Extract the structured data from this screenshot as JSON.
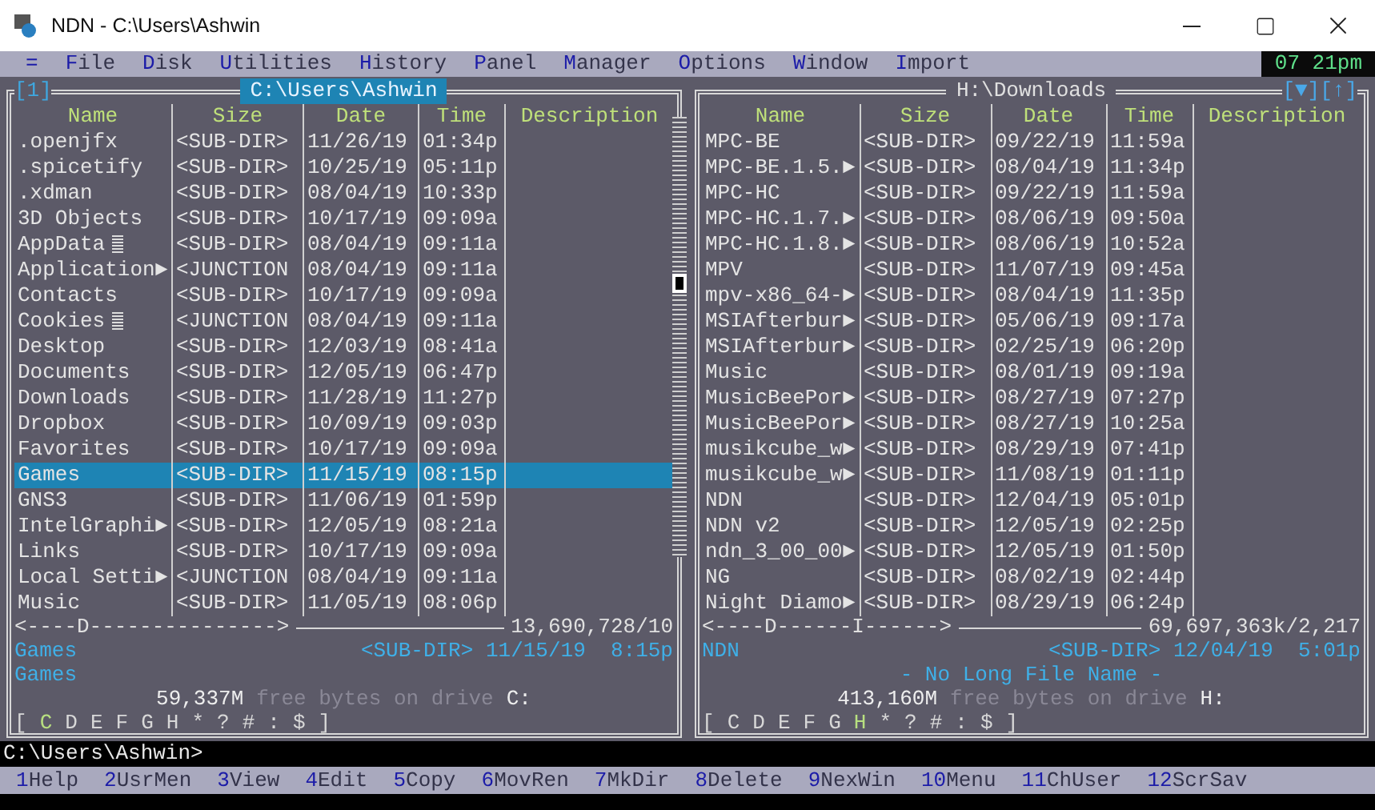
{
  "window": {
    "title": "NDN - C:\\Users\\Ashwin"
  },
  "menu": [
    {
      "label": "="
    },
    {
      "label": "File"
    },
    {
      "label": "Disk"
    },
    {
      "label": "Utilities"
    },
    {
      "label": "History"
    },
    {
      "label": "Panel"
    },
    {
      "label": "Manager"
    },
    {
      "label": "Options"
    },
    {
      "label": "Window"
    },
    {
      "label": "Import"
    }
  ],
  "clock": "07 21pm",
  "panels": [
    {
      "number": "[1]",
      "path": "C:\\Users\\Ashwin",
      "active": true,
      "columns": [
        "Name",
        "Size",
        "Date",
        "Time",
        "Description"
      ],
      "rows": [
        {
          "name": ".openjfx",
          "tagged": false,
          "size": "<SUB-DIR>",
          "date": "11/26/19",
          "time": "01:34p",
          "selected": false
        },
        {
          "name": ".spicetify",
          "tagged": false,
          "size": "<SUB-DIR>",
          "date": "10/25/19",
          "time": "05:11p",
          "selected": false
        },
        {
          "name": ".xdman",
          "tagged": false,
          "size": "<SUB-DIR>",
          "date": "08/04/19",
          "time": "10:33p",
          "selected": false
        },
        {
          "name": "3D Objects",
          "tagged": false,
          "size": "<SUB-DIR>",
          "date": "10/17/19",
          "time": "09:09a",
          "selected": false
        },
        {
          "name": "AppData",
          "tagged": true,
          "size": "<SUB-DIR>",
          "date": "08/04/19",
          "time": "09:11a",
          "selected": false
        },
        {
          "name": "Application►",
          "tagged": false,
          "size": "<JUNCTION",
          "date": "08/04/19",
          "time": "09:11a",
          "selected": false
        },
        {
          "name": "Contacts",
          "tagged": false,
          "size": "<SUB-DIR>",
          "date": "10/17/19",
          "time": "09:09a",
          "selected": false
        },
        {
          "name": "Cookies",
          "tagged": true,
          "size": "<JUNCTION",
          "date": "08/04/19",
          "time": "09:11a",
          "selected": false
        },
        {
          "name": "Desktop",
          "tagged": false,
          "size": "<SUB-DIR>",
          "date": "12/03/19",
          "time": "08:41a",
          "selected": false
        },
        {
          "name": "Documents",
          "tagged": false,
          "size": "<SUB-DIR>",
          "date": "12/05/19",
          "time": "06:47p",
          "selected": false
        },
        {
          "name": "Downloads",
          "tagged": false,
          "size": "<SUB-DIR>",
          "date": "11/28/19",
          "time": "11:27p",
          "selected": false
        },
        {
          "name": "Dropbox",
          "tagged": false,
          "size": "<SUB-DIR>",
          "date": "10/09/19",
          "time": "09:03p",
          "selected": false
        },
        {
          "name": "Favorites",
          "tagged": false,
          "size": "<SUB-DIR>",
          "date": "10/17/19",
          "time": "09:09a",
          "selected": false
        },
        {
          "name": "Games",
          "tagged": false,
          "size": "<SUB-DIR>",
          "date": "11/15/19",
          "time": "08:15p",
          "selected": true
        },
        {
          "name": "GNS3",
          "tagged": false,
          "size": "<SUB-DIR>",
          "date": "11/06/19",
          "time": "01:59p",
          "selected": false
        },
        {
          "name": "IntelGraphi►",
          "tagged": false,
          "size": "<SUB-DIR>",
          "date": "12/05/19",
          "time": "08:21a",
          "selected": false
        },
        {
          "name": "Links",
          "tagged": false,
          "size": "<SUB-DIR>",
          "date": "10/17/19",
          "time": "09:09a",
          "selected": false
        },
        {
          "name": "Local Setti►",
          "tagged": false,
          "size": "<JUNCTION",
          "date": "08/04/19",
          "time": "09:11a",
          "selected": false
        },
        {
          "name": "Music",
          "tagged": false,
          "size": "<SUB-DIR>",
          "date": "11/05/19",
          "time": "08:06p",
          "selected": false
        }
      ],
      "sort_line": "<----D--------------->",
      "totals": "13,690,728/10",
      "info": {
        "name": "Games",
        "size": "<SUB-DIR>",
        "date": "11/15/19",
        "time": "8:15p"
      },
      "long_name": {
        "kind": "name",
        "text": "Games"
      },
      "free": {
        "amount": "59,337M",
        "label": "free bytes on drive",
        "drive": "C:"
      },
      "drive_brackets": [
        "[",
        "]"
      ],
      "drives": [
        {
          "label": "C",
          "selected": true
        },
        {
          "label": "D",
          "selected": false
        },
        {
          "label": "E",
          "selected": false
        },
        {
          "label": "F",
          "selected": false
        },
        {
          "label": "G",
          "selected": false
        },
        {
          "label": "H",
          "selected": false
        },
        {
          "label": "*",
          "selected": false
        },
        {
          "label": "?",
          "selected": false
        },
        {
          "label": "#",
          "selected": false
        },
        {
          "label": ":",
          "selected": false
        },
        {
          "label": "$",
          "selected": false
        }
      ]
    },
    {
      "path": "H:\\Downloads",
      "active": false,
      "buttons": [
        "[▼]",
        "[↑]"
      ],
      "columns": [
        "Name",
        "Size",
        "Date",
        "Time",
        "Description"
      ],
      "rows": [
        {
          "name": "MPC-BE",
          "tagged": false,
          "size": "<SUB-DIR>",
          "date": "09/22/19",
          "time": "11:59a",
          "selected": false
        },
        {
          "name": "MPC-BE.1.5.►",
          "tagged": false,
          "size": "<SUB-DIR>",
          "date": "08/04/19",
          "time": "11:34p",
          "selected": false
        },
        {
          "name": "MPC-HC",
          "tagged": false,
          "size": "<SUB-DIR>",
          "date": "09/22/19",
          "time": "11:59a",
          "selected": false
        },
        {
          "name": "MPC-HC.1.7.►",
          "tagged": false,
          "size": "<SUB-DIR>",
          "date": "08/06/19",
          "time": "09:50a",
          "selected": false
        },
        {
          "name": "MPC-HC.1.8.►",
          "tagged": false,
          "size": "<SUB-DIR>",
          "date": "08/06/19",
          "time": "10:52a",
          "selected": false
        },
        {
          "name": "MPV",
          "tagged": false,
          "size": "<SUB-DIR>",
          "date": "11/07/19",
          "time": "09:45a",
          "selected": false
        },
        {
          "name": "mpv-x86_64-►",
          "tagged": false,
          "size": "<SUB-DIR>",
          "date": "08/04/19",
          "time": "11:35p",
          "selected": false
        },
        {
          "name": "MSIAfterbur►",
          "tagged": false,
          "size": "<SUB-DIR>",
          "date": "05/06/19",
          "time": "09:17a",
          "selected": false
        },
        {
          "name": "MSIAfterbur►",
          "tagged": false,
          "size": "<SUB-DIR>",
          "date": "02/25/19",
          "time": "06:20p",
          "selected": false
        },
        {
          "name": "Music",
          "tagged": false,
          "size": "<SUB-DIR>",
          "date": "08/01/19",
          "time": "09:19a",
          "selected": false
        },
        {
          "name": "MusicBeePor►",
          "tagged": false,
          "size": "<SUB-DIR>",
          "date": "08/27/19",
          "time": "07:27p",
          "selected": false
        },
        {
          "name": "MusicBeePor►",
          "tagged": false,
          "size": "<SUB-DIR>",
          "date": "08/27/19",
          "time": "10:25a",
          "selected": false
        },
        {
          "name": "musikcube_w►",
          "tagged": false,
          "size": "<SUB-DIR>",
          "date": "08/29/19",
          "time": "07:41p",
          "selected": false
        },
        {
          "name": "musikcube_w►",
          "tagged": false,
          "size": "<SUB-DIR>",
          "date": "11/08/19",
          "time": "01:11p",
          "selected": false
        },
        {
          "name": "NDN",
          "tagged": false,
          "size": "<SUB-DIR>",
          "date": "12/04/19",
          "time": "05:01p",
          "selected": false
        },
        {
          "name": "NDN v2",
          "tagged": false,
          "size": "<SUB-DIR>",
          "date": "12/05/19",
          "time": "02:25p",
          "selected": false
        },
        {
          "name": "ndn_3_00_00►",
          "tagged": false,
          "size": "<SUB-DIR>",
          "date": "12/05/19",
          "time": "01:50p",
          "selected": false
        },
        {
          "name": "NG",
          "tagged": false,
          "size": "<SUB-DIR>",
          "date": "08/02/19",
          "time": "02:44p",
          "selected": false
        },
        {
          "name": "Night Diamo►",
          "tagged": false,
          "size": "<SUB-DIR>",
          "date": "08/29/19",
          "time": "06:24p",
          "selected": false
        }
      ],
      "sort_line": "<----D------I------>",
      "totals": "69,697,363k/2,217",
      "info": {
        "name": "NDN",
        "size": "<SUB-DIR>",
        "date": "12/04/19",
        "time": "5:01p"
      },
      "long_name": {
        "kind": "notice",
        "text": "- No Long File Name -"
      },
      "free": {
        "amount": "413,160M",
        "label": "free bytes on drive",
        "drive": "H:"
      },
      "drive_brackets": [
        "[",
        "]"
      ],
      "drives": [
        {
          "label": "C",
          "selected": false
        },
        {
          "label": "D",
          "selected": false
        },
        {
          "label": "E",
          "selected": false
        },
        {
          "label": "F",
          "selected": false
        },
        {
          "label": "G",
          "selected": false
        },
        {
          "label": "H",
          "selected": true
        },
        {
          "label": "*",
          "selected": false
        },
        {
          "label": "?",
          "selected": false
        },
        {
          "label": "#",
          "selected": false
        },
        {
          "label": ":",
          "selected": false
        },
        {
          "label": "$",
          "selected": false
        }
      ]
    }
  ],
  "command_line": "C:\\Users\\Ashwin>",
  "function_keys": [
    {
      "key": "1",
      "label": "Help"
    },
    {
      "key": "2",
      "label": "UsrMen"
    },
    {
      "key": "3",
      "label": "View"
    },
    {
      "key": "4",
      "label": "Edit"
    },
    {
      "key": "5",
      "label": "Copy"
    },
    {
      "key": "6",
      "label": "MovRen"
    },
    {
      "key": "7",
      "label": "MkDir"
    },
    {
      "key": "8",
      "label": "Delete"
    },
    {
      "key": "9",
      "label": "NexWin"
    },
    {
      "key": "10",
      "label": "Menu"
    },
    {
      "key": "11",
      "label": "ChUser"
    },
    {
      "key": "12",
      "label": "ScrSav"
    }
  ]
}
